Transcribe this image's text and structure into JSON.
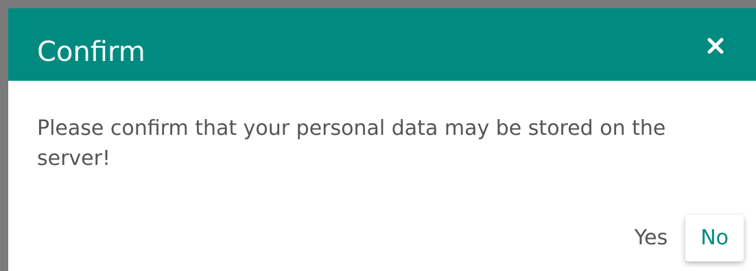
{
  "dialog": {
    "title": "Confirm",
    "message": "Please confirm that your personal data may be stored on the server!",
    "close_icon": "close-icon",
    "buttons": {
      "yes_label": "Yes",
      "no_label": "No"
    }
  },
  "colors": {
    "header_background": "#008a80",
    "header_text": "#ffffff",
    "body_text": "#555555",
    "primary_button_text": "#008a80",
    "frame": "#7a7a7a"
  }
}
